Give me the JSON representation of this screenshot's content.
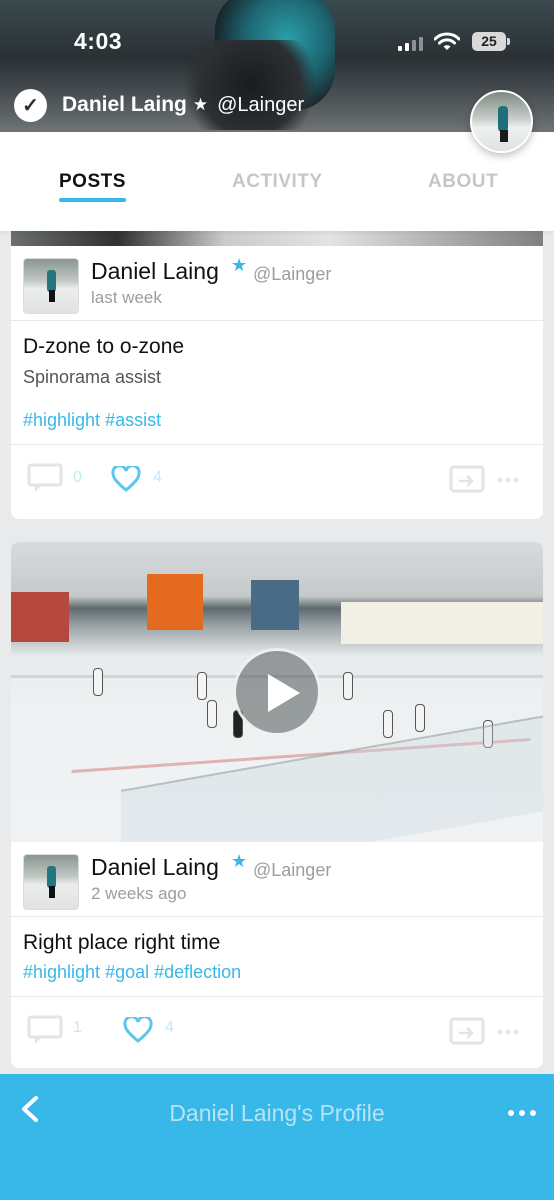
{
  "status_bar": {
    "time": "4:03",
    "battery": "25"
  },
  "profile": {
    "name": "Daniel Laing",
    "handle": "@Lainger"
  },
  "tabs": [
    {
      "label": "POSTS",
      "active": true
    },
    {
      "label": "ACTIVITY",
      "active": false
    },
    {
      "label": "ABOUT",
      "active": false
    }
  ],
  "posts": [
    {
      "author": "Daniel Laing",
      "handle": "@Lainger",
      "when": "last week",
      "title": "D-zone to o-zone",
      "body": "Spinorama assist",
      "tags": "#highlight #assist",
      "comment_count": "0",
      "like_count": "4"
    },
    {
      "author": "Daniel Laing",
      "handle": "@Lainger",
      "when": "2 weeks ago",
      "title": "Right place right time",
      "tags": "#highlight #goal #deflection",
      "comment_count": "1",
      "like_count": "4"
    }
  ],
  "bottom_bar": {
    "title": "Daniel Laing's Profile"
  },
  "colors": {
    "accent": "#37b8e8",
    "text": "#111111",
    "muted": "#9a9ea1"
  }
}
